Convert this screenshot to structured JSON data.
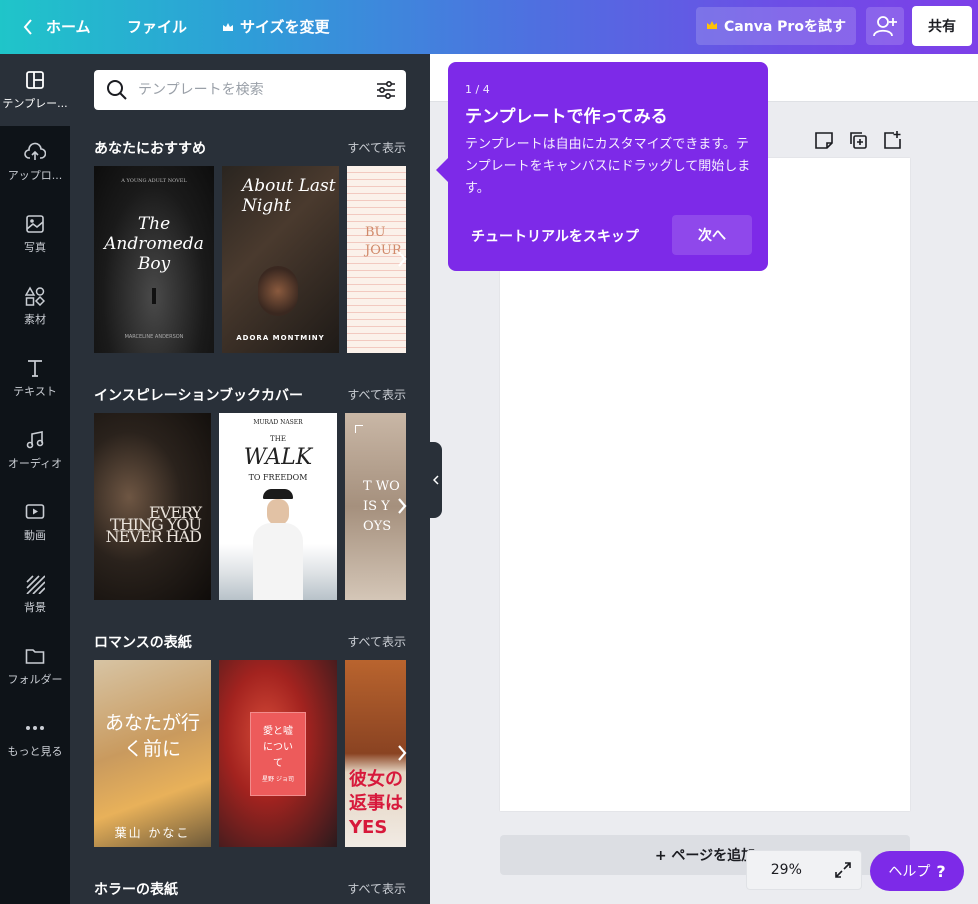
{
  "topbar": {
    "home": "ホーム",
    "file": "ファイル",
    "resize": "サイズを変更",
    "pro": "Canva Proを試す",
    "share": "共有"
  },
  "rail": [
    {
      "label": "テンプレー...",
      "icon": "template-icon"
    },
    {
      "label": "アップロ...",
      "icon": "upload-cloud-icon"
    },
    {
      "label": "写真",
      "icon": "photo-icon"
    },
    {
      "label": "素材",
      "icon": "elements-icon"
    },
    {
      "label": "テキスト",
      "icon": "text-icon"
    },
    {
      "label": "オーディオ",
      "icon": "music-note-icon"
    },
    {
      "label": "動画",
      "icon": "video-icon"
    },
    {
      "label": "背景",
      "icon": "background-pattern-icon"
    },
    {
      "label": "フォルダー",
      "icon": "folder-icon"
    },
    {
      "label": "もっと見る",
      "icon": "more-dots-icon"
    }
  ],
  "search": {
    "placeholder": "テンプレートを検索"
  },
  "sections": [
    {
      "title": "あなたにおすすめ",
      "see_all": "すべて表示"
    },
    {
      "title": "インスピレーションブックカバー",
      "see_all": "すべて表示"
    },
    {
      "title": "ロマンスの表紙",
      "see_all": "すべて表示"
    },
    {
      "title": "ホラーの表紙",
      "see_all": "すべて表示"
    }
  ],
  "thumbs": {
    "andromeda_top": "A YOUNG ADULT NOVEL",
    "andromeda_title": "The Andromeda Boy",
    "andromeda_author": "MARCELINE ANDERSON",
    "about_title": "About Last Night",
    "about_author": "ADORA MONTMINY",
    "journey_title": "BU JOUR",
    "everything_title": "EVERY THING YOU NEVER HAD",
    "walk_author": "MURAD NASER",
    "walk_the": "THE",
    "walk_title": "WALK",
    "walk_sub": "TO FREEDOM",
    "oyster_title": "T WO IS Y OYS",
    "romance1_title": "あなたが行く前に",
    "romance1_author": "葉山 かなこ",
    "romance2_title": "愛と嘘について",
    "romance2_author": "星野 ジョ司",
    "romance3_title": "彼女の返事はYES"
  },
  "tutorial": {
    "step": "1 / 4",
    "title": "テンプレートで作ってみる",
    "body": "テンプレートは自由にカスタマイズできます。テンプレートをキャンバスにドラッグして開始します。",
    "skip": "チュートリアルをスキップ",
    "next": "次へ"
  },
  "canvas": {
    "add_page": "+ ページを追加",
    "zoom": "29%",
    "help": "ヘルプ",
    "help_q": "?"
  }
}
